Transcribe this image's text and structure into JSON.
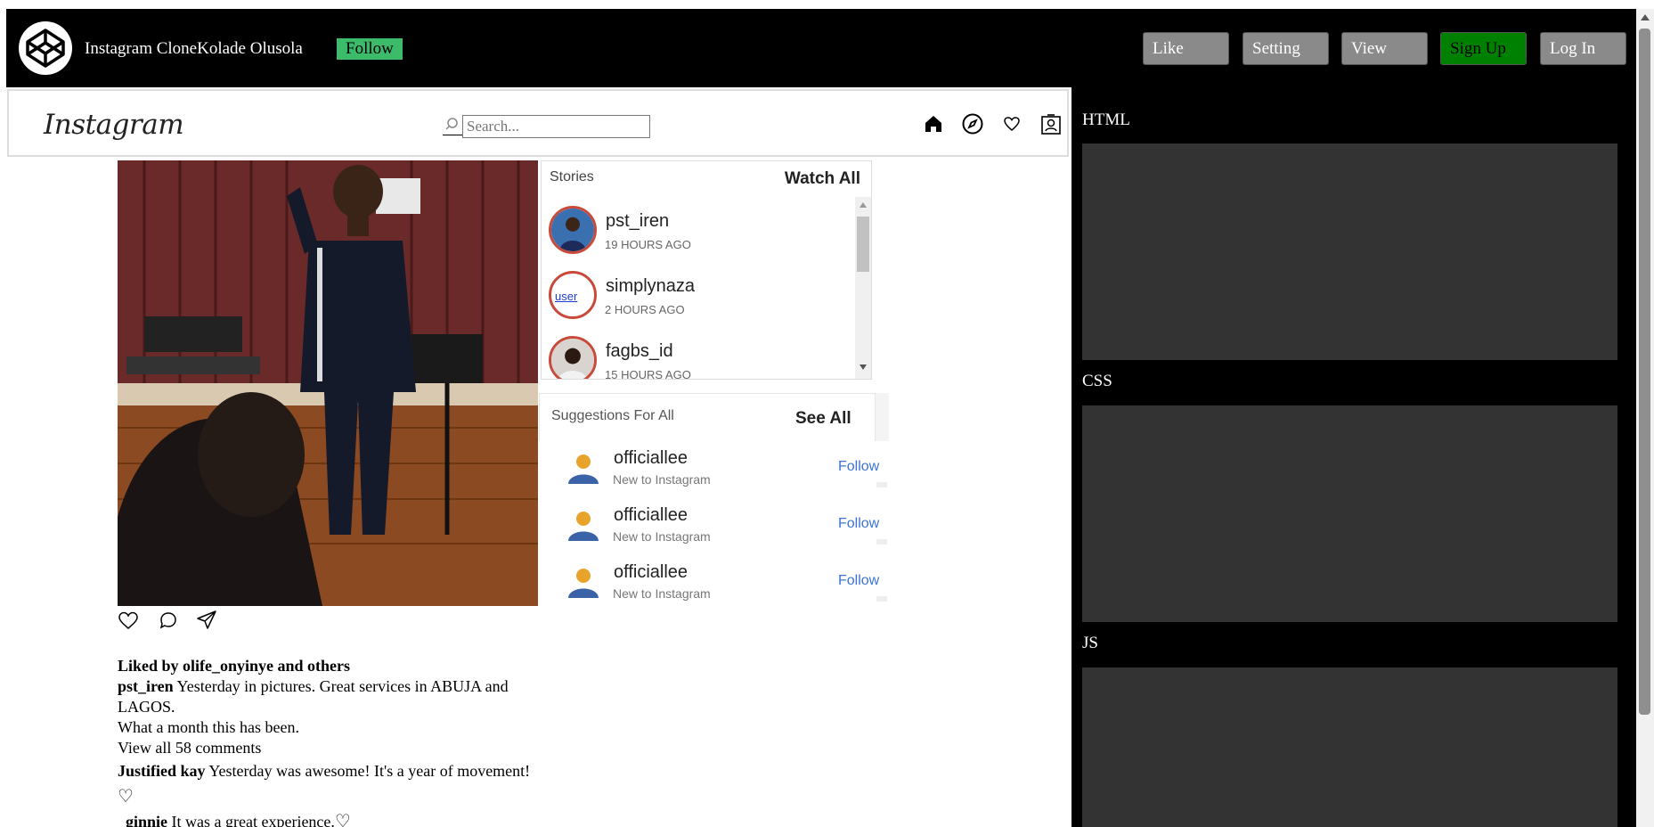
{
  "header": {
    "title": "Instagram CloneKolade Olusola",
    "follow_label": "Follow",
    "buttons": {
      "like": "Like",
      "setting": "Setting",
      "view": "View",
      "signup": "Sign Up",
      "login": "Log In"
    }
  },
  "nav": {
    "logo_text": "Instagram",
    "search_placeholder": "Search...",
    "icons": [
      "home-icon",
      "explore-compass-icon",
      "heart-icon",
      "profile-icon"
    ]
  },
  "post": {
    "liked_by": "Liked by olife_onyinye and others",
    "caption_user": "pst_iren",
    "caption_text": " Yesterday in pictures. Great services in ABUJA and LAGOS.",
    "caption_line2": "What a month this has been.",
    "view_comments": "View all 58 comments",
    "comments": [
      {
        "user": "Justified kay",
        "text": " Yesterday was awesome! It's a year of movement! ",
        "heart": "♡"
      },
      {
        "user": "_ginnie",
        "text": " It was a great experience.",
        "heart": "♡"
      }
    ]
  },
  "stories": {
    "title": "Stories",
    "watch_all": "Watch All",
    "items": [
      {
        "name": "pst_iren",
        "time": "19 HOURS AGO"
      },
      {
        "name": "simplynaza",
        "time": "2 HOURS AGO",
        "broken_alt": "user"
      },
      {
        "name": "fagbs_id",
        "time": "15 HOURS AGO"
      }
    ]
  },
  "suggestions": {
    "title": "Suggestions For All",
    "see_all": "See All",
    "items": [
      {
        "name": "officiallee",
        "sub": "New to Instagram",
        "follow": "Follow"
      },
      {
        "name": "officiallee",
        "sub": "New to Instagram",
        "follow": "Follow"
      },
      {
        "name": "officiallee",
        "sub": "New to Instagram",
        "follow": "Follow"
      }
    ]
  },
  "side_panels": {
    "html_label": "HTML",
    "css_label": "CSS",
    "js_label": "JS"
  },
  "colors": {
    "header_bg": "#000000",
    "follow_green": "#3cbc6a",
    "signup_green": "#008000",
    "panel_gray": "#333333",
    "story_ring": "#c84a3a",
    "link_blue": "#3b74d8"
  }
}
